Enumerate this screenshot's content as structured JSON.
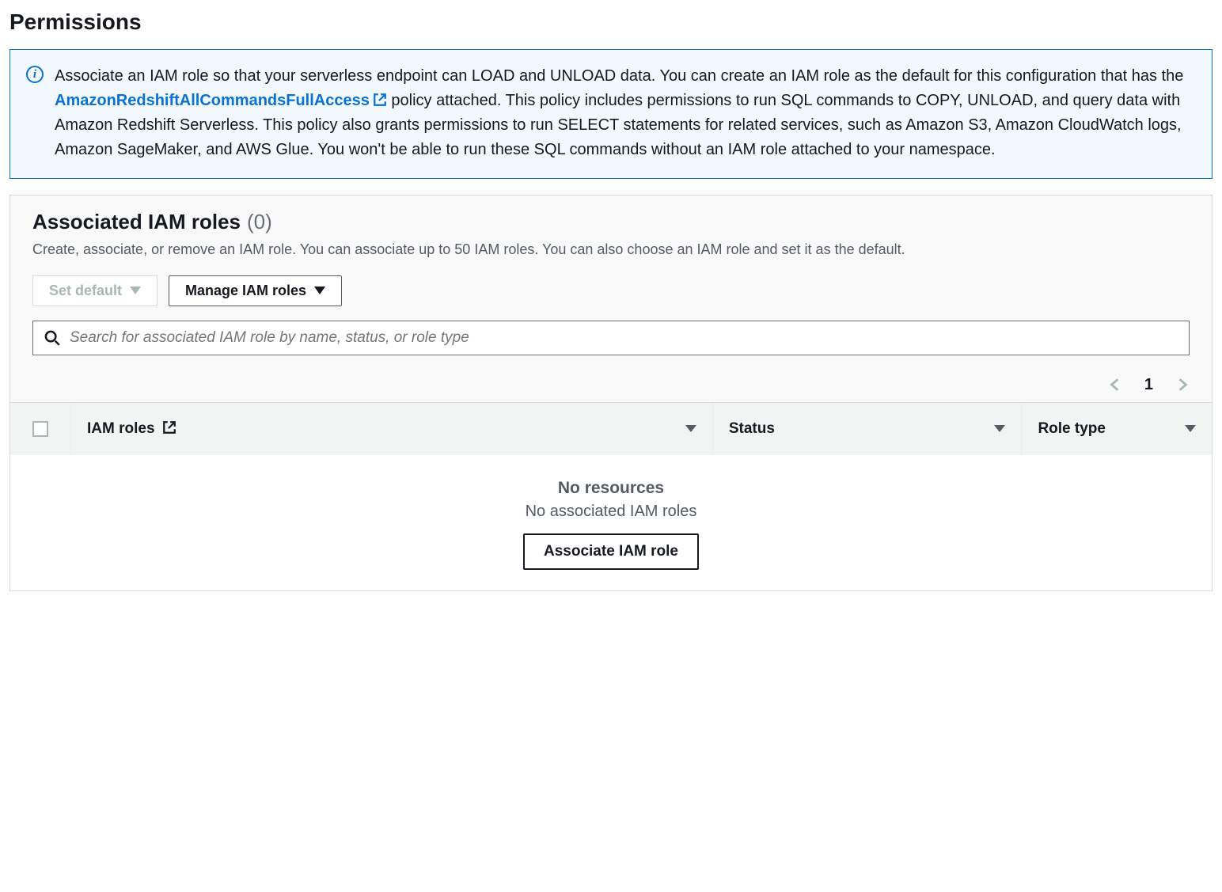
{
  "page": {
    "title": "Permissions"
  },
  "banner": {
    "text_before_link": "Associate an IAM role so that your serverless endpoint can LOAD and UNLOAD data. You can create an IAM role as the default for this configuration that has the ",
    "link_text": "AmazonRedshiftAllCommandsFullAccess",
    "text_after_link": " policy attached. This policy includes permissions to run SQL commands to COPY, UNLOAD, and query data with Amazon Redshift Serverless. This policy also grants permissions to run SELECT statements for related services, such as Amazon S3, Amazon CloudWatch logs, Amazon SageMaker, and AWS Glue. You won't be able to run these SQL commands without an IAM role attached to your namespace."
  },
  "panel": {
    "title": "Associated IAM roles",
    "count_display": "(0)",
    "description": "Create, associate, or remove an IAM role. You can associate up to 50 IAM roles. You can also choose an IAM role and set it as the default.",
    "buttons": {
      "set_default": "Set default",
      "manage": "Manage IAM roles"
    },
    "search_placeholder": "Search for associated IAM role by name, status, or role type",
    "pagination": {
      "current": "1"
    },
    "columns": {
      "iam_roles": "IAM roles",
      "status": "Status",
      "role_type": "Role type"
    },
    "empty": {
      "title": "No resources",
      "subtitle": "No associated IAM roles",
      "button": "Associate IAM role"
    }
  }
}
